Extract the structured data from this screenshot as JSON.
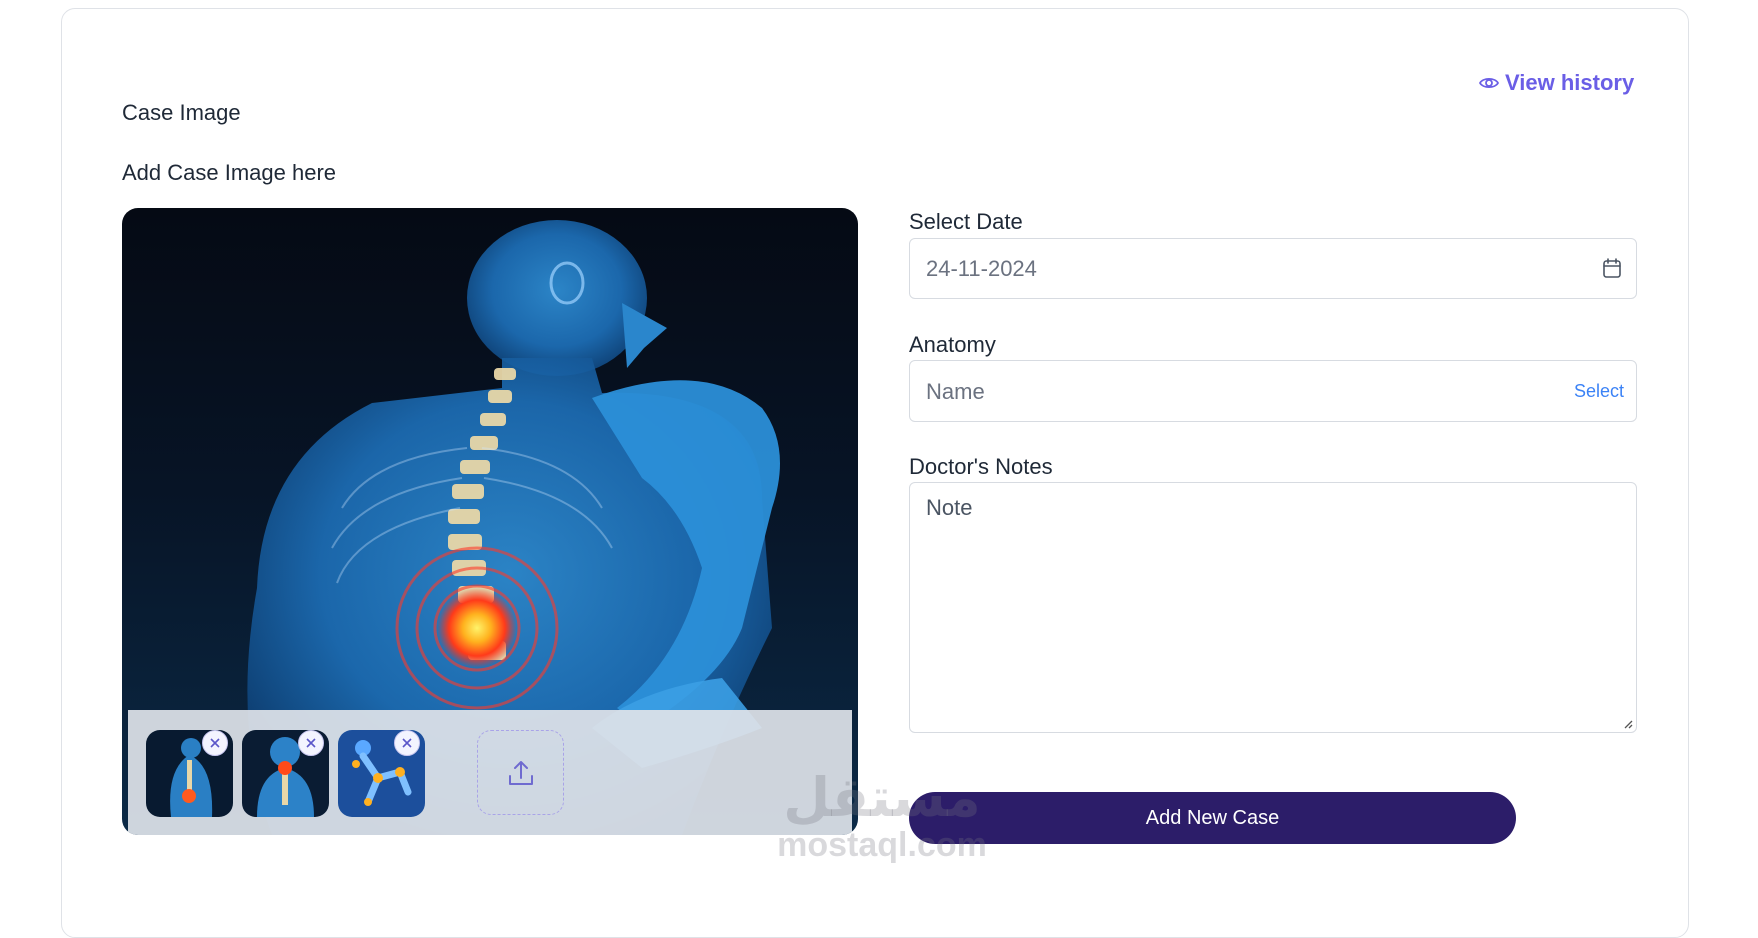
{
  "header": {
    "view_history_label": "View history"
  },
  "case_image": {
    "title": "Case Image",
    "subtitle": "Add Case Image here",
    "thumbnails": [
      {
        "icon": "spine-thumbnail"
      },
      {
        "icon": "neck-thumbnail"
      },
      {
        "icon": "joints-thumbnail"
      }
    ],
    "upload_icon": "upload-icon"
  },
  "form": {
    "date_label": "Select Date",
    "date_value": "24-11-2024",
    "anatomy_label": "Anatomy",
    "anatomy_placeholder": "Name",
    "anatomy_select_label": "Select",
    "notes_label": "Doctor's Notes",
    "notes_placeholder": "Note",
    "submit_label": "Add New Case"
  },
  "watermark": {
    "arabic": "مستقل",
    "latin": "mostaql.com"
  },
  "colors": {
    "accent": "#6a5ee6",
    "button": "#2c1d69",
    "link": "#3b82f6"
  }
}
